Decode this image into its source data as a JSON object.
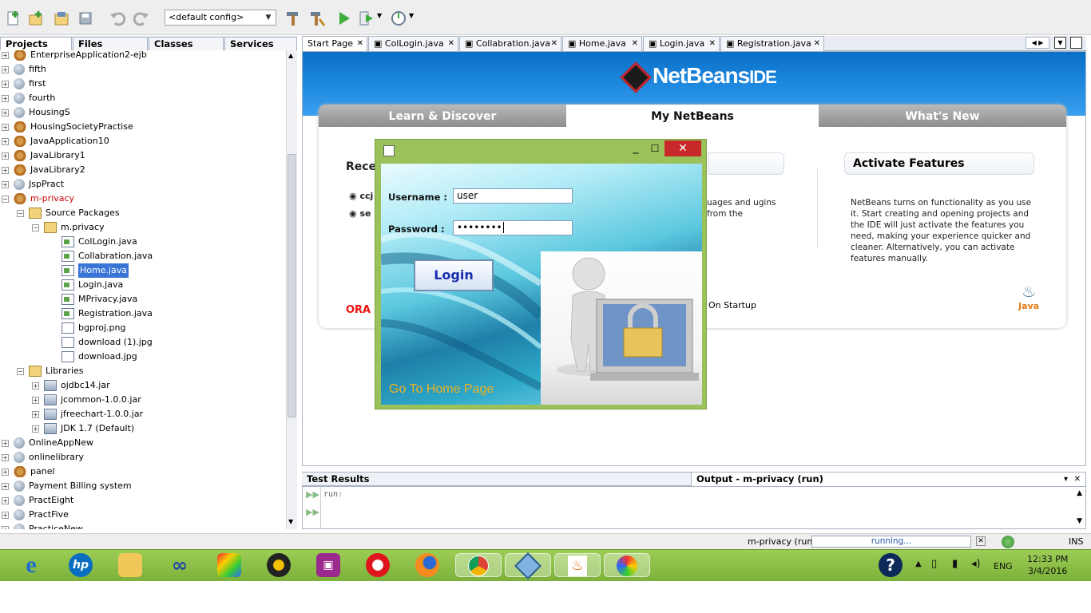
{
  "toolbar": {
    "config_value": "<default config>"
  },
  "left_tabs": [
    "Projects",
    "Files",
    "Classes",
    "Services"
  ],
  "tree": [
    {
      "label": "EnterpriseApplication2-ejb",
      "type": "proj"
    },
    {
      "label": "fifth",
      "type": "globe"
    },
    {
      "label": "first",
      "type": "globe"
    },
    {
      "label": "fourth",
      "type": "globe"
    },
    {
      "label": "HousingS",
      "type": "globe"
    },
    {
      "label": "HousingSocietyPractise",
      "type": "proj"
    },
    {
      "label": "JavaApplication10",
      "type": "proj"
    },
    {
      "label": "JavaLibrary1",
      "type": "proj"
    },
    {
      "label": "JavaLibrary2",
      "type": "proj"
    },
    {
      "label": "JspPract",
      "type": "globe"
    },
    {
      "label": "m-privacy",
      "type": "proj"
    },
    {
      "label": "Source Packages",
      "type": "pkg"
    },
    {
      "label": "m.privacy",
      "type": "pkg"
    },
    {
      "label": "ColLogin.java",
      "type": "java"
    },
    {
      "label": "Collabration.java",
      "type": "java"
    },
    {
      "label": "Home.java",
      "type": "java"
    },
    {
      "label": "Login.java",
      "type": "java"
    },
    {
      "label": "MPrivacy.java",
      "type": "java"
    },
    {
      "label": "Registration.java",
      "type": "java"
    },
    {
      "label": "bgproj.png",
      "type": "img"
    },
    {
      "label": "download (1).jpg",
      "type": "img"
    },
    {
      "label": "download.jpg",
      "type": "img"
    },
    {
      "label": "Libraries",
      "type": "pkg"
    },
    {
      "label": "ojdbc14.jar",
      "type": "jar"
    },
    {
      "label": "jcommon-1.0.0.jar",
      "type": "jar"
    },
    {
      "label": "jfreechart-1.0.0.jar",
      "type": "jar"
    },
    {
      "label": "JDK 1.7 (Default)",
      "type": "jar"
    },
    {
      "label": "OnlineAppNew",
      "type": "globe"
    },
    {
      "label": "onlinelibrary",
      "type": "globe"
    },
    {
      "label": "panel",
      "type": "proj"
    },
    {
      "label": "Payment Billing system",
      "type": "globe"
    },
    {
      "label": "PractEight",
      "type": "globe"
    },
    {
      "label": "PractFive",
      "type": "globe"
    },
    {
      "label": "PracticeNew",
      "type": "globe"
    }
  ],
  "editor_tabs": [
    "Start Page",
    "ColLogin.java",
    "Collabration.java",
    "Home.java",
    "Login.java",
    "Registration.java"
  ],
  "start_page": {
    "logo": "NetBeans",
    "logo_suffix": "IDE",
    "tabs": [
      "Learn & Discover",
      "My NetBeans",
      "What's New"
    ],
    "recent_label": "Rece",
    "recent_links": [
      "ccj",
      "se"
    ],
    "mid_text": "uages and ugins from the",
    "activate_title": "Activate Features",
    "activate_text": "NetBeans turns on functionality as you use it. Start creating and opening projects and the IDE will just activate the features you need, making your experience quicker and cleaner. Alternatively, you can activate features manually.",
    "on_startup": "On Startup",
    "oracle": "ORA",
    "java": "Java"
  },
  "login": {
    "username_label": "Username :",
    "username_value": "user",
    "password_label": "Password :",
    "password_value": "••••••••",
    "login_button": "Login",
    "go_home": "Go To Home Page"
  },
  "bottom": {
    "test_results": "Test Results",
    "output_title": "Output - m-privacy (run)",
    "output_line": "run:"
  },
  "status": {
    "project": "m-privacy (run)",
    "progress": "running...",
    "mode": "INS"
  },
  "taskbar": {
    "lang": "ENG",
    "time": "12:33 PM",
    "date": "3/4/2016"
  }
}
